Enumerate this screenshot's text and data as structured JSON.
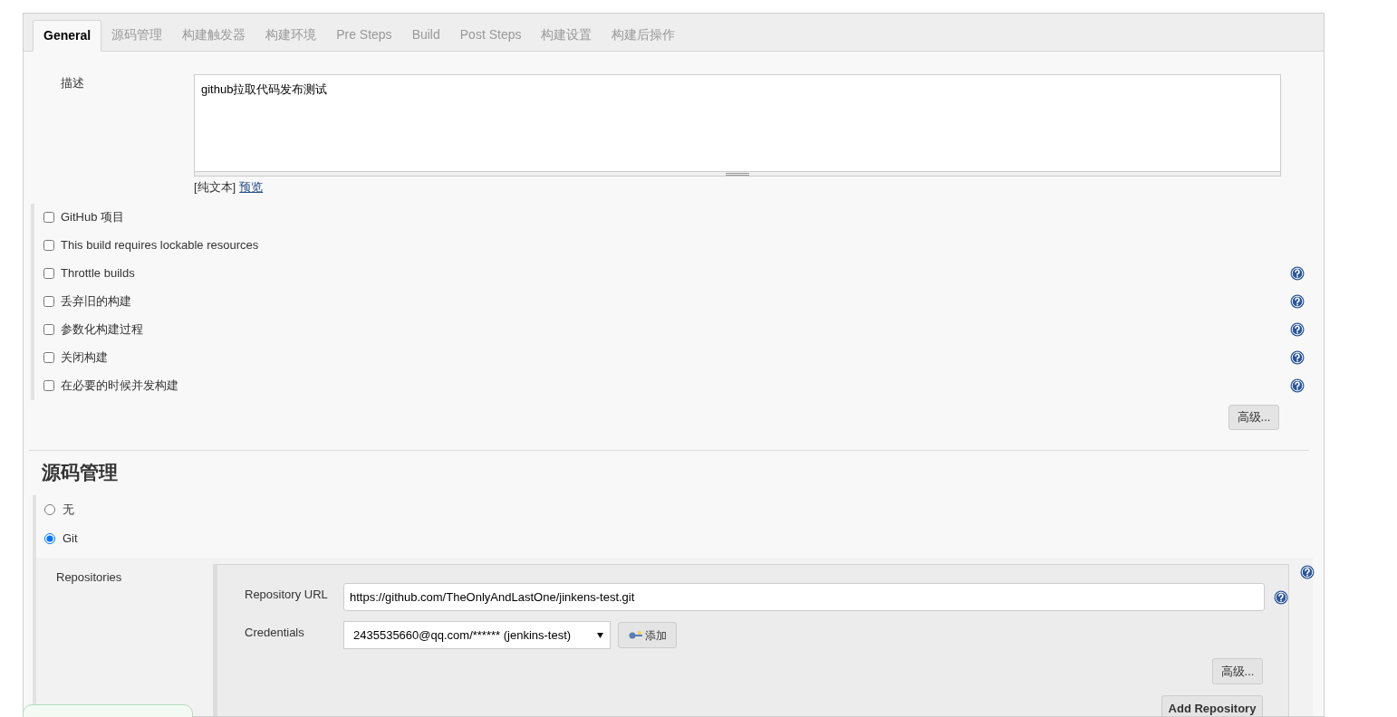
{
  "tabs": [
    {
      "label": "General",
      "selected": true
    },
    {
      "label": "源码管理",
      "selected": false
    },
    {
      "label": "构建触发器",
      "selected": false
    },
    {
      "label": "构建环境",
      "selected": false
    },
    {
      "label": "Pre Steps",
      "selected": false
    },
    {
      "label": "Build",
      "selected": false
    },
    {
      "label": "Post Steps",
      "selected": false
    },
    {
      "label": "构建设置",
      "selected": false
    },
    {
      "label": "构建后操作",
      "selected": false
    }
  ],
  "description": {
    "label": "描述",
    "value": "github拉取代码发布测试",
    "format_label": "[纯文本]",
    "preview_link": "预览"
  },
  "options": [
    {
      "label": "GitHub 项目",
      "checked": false,
      "help": false
    },
    {
      "label": "This build requires lockable resources",
      "checked": false,
      "help": false
    },
    {
      "label": "Throttle builds",
      "checked": false,
      "help": true
    },
    {
      "label": "丢弃旧的构建",
      "checked": false,
      "help": true
    },
    {
      "label": "参数化构建过程",
      "checked": false,
      "help": true
    },
    {
      "label": "关闭构建",
      "checked": false,
      "help": true
    },
    {
      "label": "在必要的时候并发构建",
      "checked": false,
      "help": true
    }
  ],
  "advanced_button": "高级...",
  "scm": {
    "heading": "源码管理",
    "choices": [
      {
        "label": "无",
        "selected": false
      },
      {
        "label": "Git",
        "selected": true
      }
    ],
    "repositories_label": "Repositories",
    "url_label": "Repository URL",
    "url_value": "https://github.com/TheOnlyAndLastOne/jinkens-test.git",
    "credentials_label": "Credentials",
    "credentials_value": "2435535660@qq.com/****** (jenkins-test)",
    "add_button": "添加",
    "advanced_button": "高级...",
    "add_repository_button": "Add Repository"
  }
}
